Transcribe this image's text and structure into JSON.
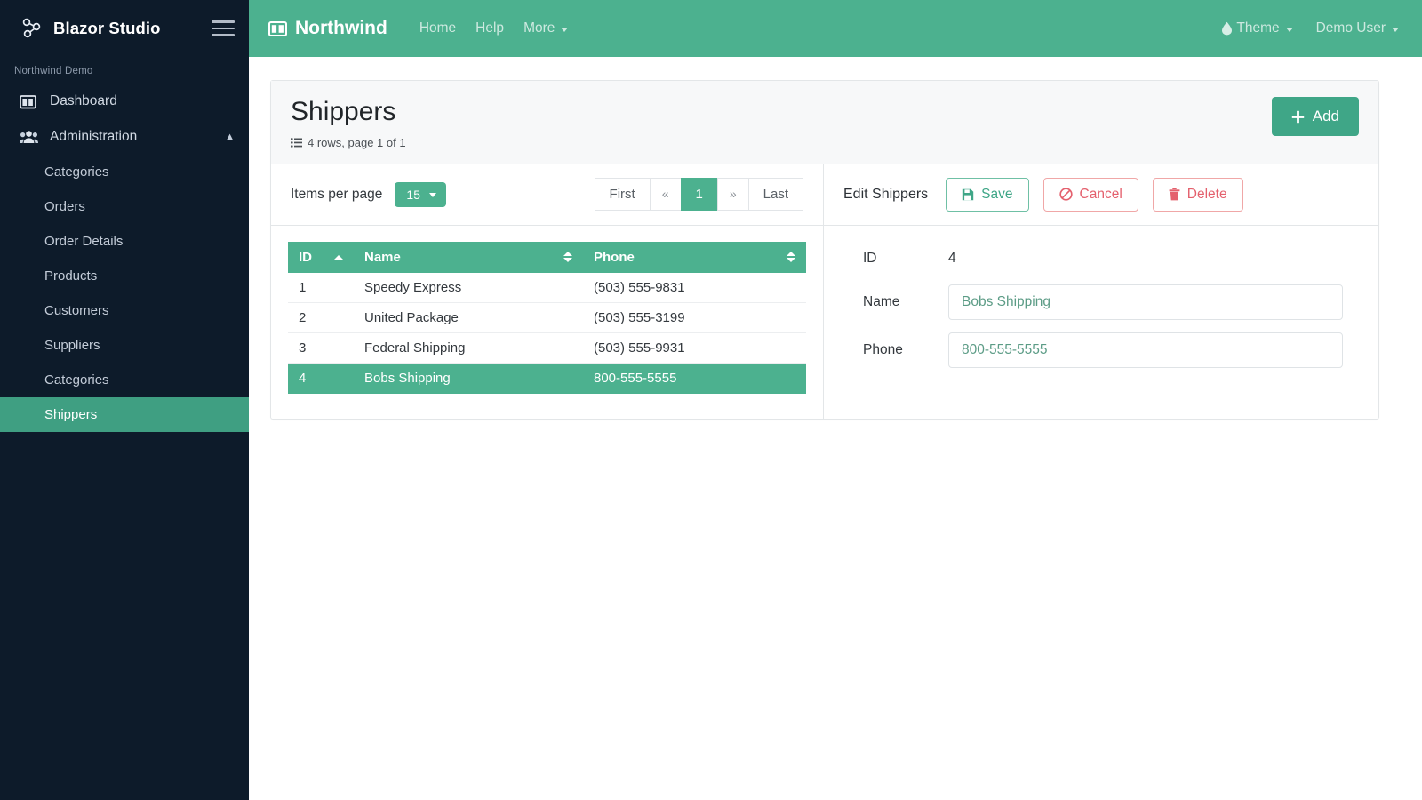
{
  "theme": {
    "green": "#4cb18f",
    "green_dark": "#3fa687",
    "sidebar_bg": "#0d1b2a",
    "danger": "#e4606d"
  },
  "sidebar": {
    "brand": "Blazor Studio",
    "brand_logo_icon": "node-graph-icon",
    "menu_toggle_icon": "hamburger-icon",
    "section_title": "Northwind Demo",
    "items": [
      {
        "label": "Dashboard",
        "icon": "dashboard-columns-icon",
        "active": false
      },
      {
        "label": "Administration",
        "icon": "users-group-icon",
        "expanded": true,
        "caret": "▲"
      }
    ],
    "sub_items": [
      {
        "label": "Categories",
        "active": false
      },
      {
        "label": "Orders",
        "active": false
      },
      {
        "label": "Order Details",
        "active": false
      },
      {
        "label": "Products",
        "active": false
      },
      {
        "label": "Customers",
        "active": false
      },
      {
        "label": "Suppliers",
        "active": false
      },
      {
        "label": "Categories",
        "active": false
      },
      {
        "label": "Shippers",
        "active": true
      }
    ]
  },
  "topnav": {
    "brand": "Northwind",
    "brand_icon": "table-columns-icon",
    "links": [
      {
        "label": "Home",
        "has_caret": false
      },
      {
        "label": "Help",
        "has_caret": false
      },
      {
        "label": "More",
        "has_caret": true
      }
    ],
    "theme_menu": {
      "label": "Theme",
      "icon": "droplet-icon",
      "has_caret": true
    },
    "user_menu": {
      "label": "Demo User",
      "has_caret": true
    }
  },
  "page": {
    "title": "Shippers",
    "rows_meta": "4 rows, page 1 of 1",
    "rows_meta_icon": "list-ul-icon",
    "add_button": {
      "label": "Add",
      "icon": "plus-icon"
    }
  },
  "toolbar": {
    "items_per_page_label": "Items per page",
    "items_per_page_value": "15",
    "pager": [
      {
        "label": "First",
        "type": "text",
        "active": false
      },
      {
        "label": "«",
        "type": "sym",
        "active": false
      },
      {
        "label": "1",
        "type": "page",
        "active": true
      },
      {
        "label": "»",
        "type": "sym",
        "active": false
      },
      {
        "label": "Last",
        "type": "text",
        "active": false
      }
    ],
    "edit_label": "Edit Shippers",
    "save": {
      "label": "Save",
      "icon": "floppy-save-icon"
    },
    "cancel": {
      "label": "Cancel",
      "icon": "ban-circle-icon"
    },
    "delete": {
      "label": "Delete",
      "icon": "trash-icon"
    }
  },
  "table": {
    "columns": [
      {
        "key": "id",
        "label": "ID",
        "sort": "asc"
      },
      {
        "key": "name",
        "label": "Name",
        "sort": "none"
      },
      {
        "key": "phone",
        "label": "Phone",
        "sort": "none"
      }
    ],
    "rows": [
      {
        "id": "1",
        "name": "Speedy Express",
        "phone": "(503) 555-9831",
        "selected": false
      },
      {
        "id": "2",
        "name": "United Package",
        "phone": "(503) 555-3199",
        "selected": false
      },
      {
        "id": "3",
        "name": "Federal Shipping",
        "phone": "(503) 555-9931",
        "selected": false
      },
      {
        "id": "4",
        "name": "Bobs Shipping",
        "phone": "800-555-5555",
        "selected": true
      }
    ]
  },
  "form": {
    "id_label": "ID",
    "id_value": "4",
    "name_label": "Name",
    "name_value": "Bobs Shipping",
    "name_placeholder": "Bobs Shipping",
    "phone_label": "Phone",
    "phone_value": "800-555-5555",
    "phone_placeholder": "800-555-5555"
  }
}
